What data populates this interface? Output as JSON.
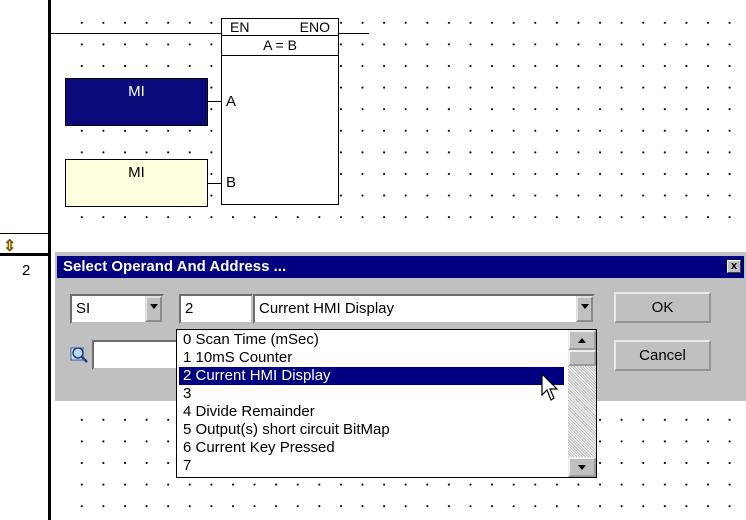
{
  "ladder": {
    "rung_number": "2",
    "function_block": {
      "en_label": "EN",
      "eno_label": "ENO",
      "function_label": "A = B",
      "input_a_label": "A",
      "input_b_label": "B"
    },
    "operand_a": {
      "label": "MI",
      "color": "#0a0a7a"
    },
    "operand_b": {
      "label": "MI",
      "color": "#ffffe0"
    },
    "rung_marker": "⇕"
  },
  "dialog": {
    "title": "Select Operand And Address ...",
    "close_label": "x",
    "operand_type": "SI",
    "address_value": "2",
    "address_description": "Current HMI Display",
    "search_value": "",
    "ok_label": "OK",
    "cancel_label": "Cancel",
    "list_items": [
      "0  Scan Time (mSec)",
      "1  10mS Counter",
      "2  Current HMI Display",
      "3",
      "4  Divide Remainder",
      "5  Output(s) short circuit BitMap",
      "6  Current Key Pressed",
      "7"
    ],
    "selected_index": 2
  },
  "colors": {
    "selection": "#000080",
    "titlebar": "#000080",
    "dialog_face": "#c0c0c0"
  }
}
